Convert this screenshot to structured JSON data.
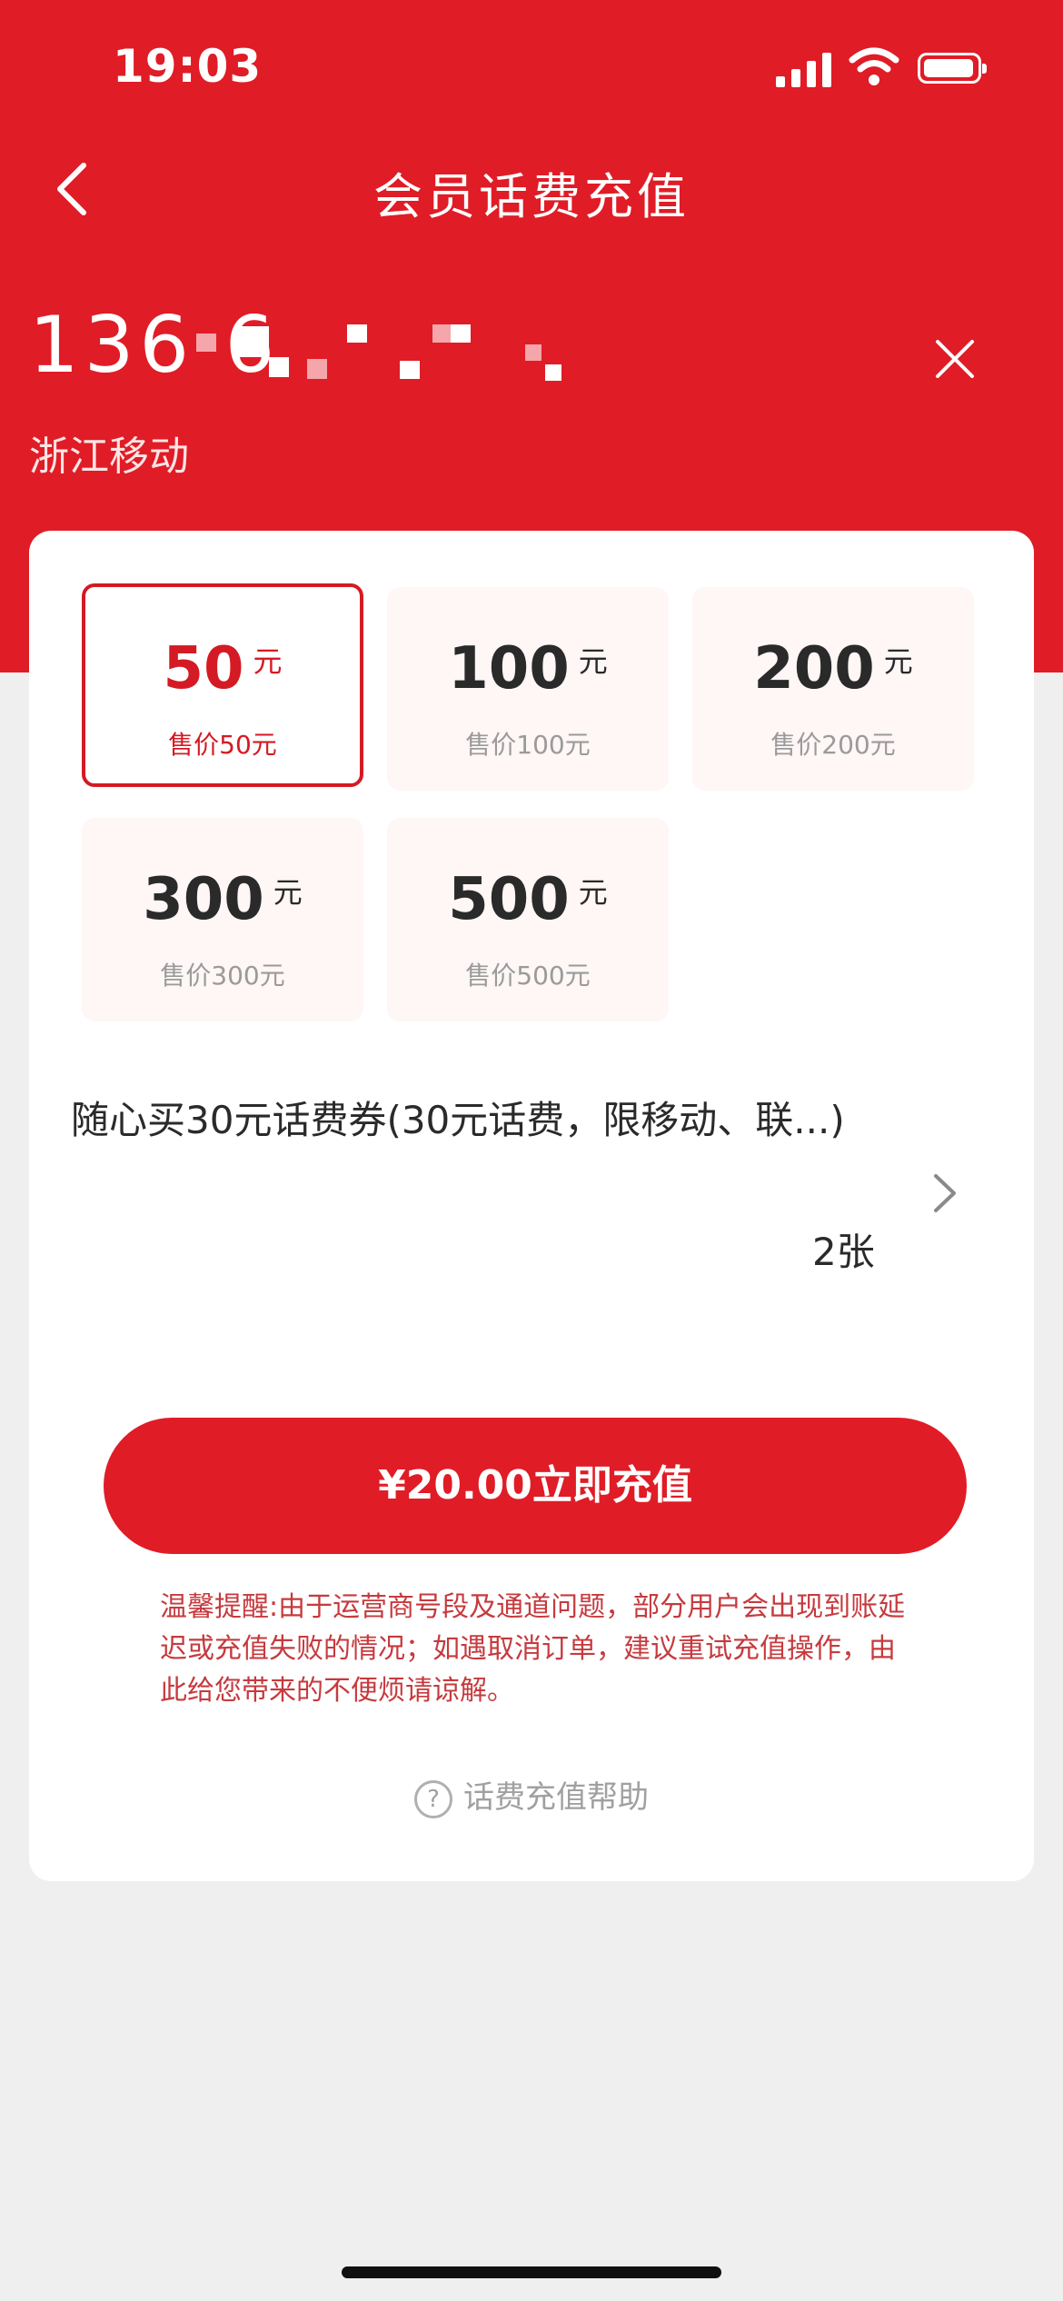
{
  "status_bar": {
    "time": "19:03"
  },
  "header": {
    "title": "会员话费充值"
  },
  "phone": {
    "number": "136 6",
    "carrier": "浙江移动"
  },
  "options": [
    {
      "amount": "50",
      "unit": "元",
      "price": "售价50元",
      "selected": true
    },
    {
      "amount": "100",
      "unit": "元",
      "price": "售价100元",
      "selected": false
    },
    {
      "amount": "200",
      "unit": "元",
      "price": "售价200元",
      "selected": false
    },
    {
      "amount": "300",
      "unit": "元",
      "price": "售价300元",
      "selected": false
    },
    {
      "amount": "500",
      "unit": "元",
      "price": "售价500元",
      "selected": false
    }
  ],
  "coupon": {
    "title": "随心买30元话费券(30元话费，限移动、联...)",
    "count": "2张"
  },
  "pay_button": {
    "label": "¥20.00立即充值"
  },
  "notice": "温馨提醒:由于运营商号段及通道问题，部分用户会出现到账延迟或充值失败的情况；如遇取消订单，建议重试充值操作，由此给您带来的不便烦请谅解。",
  "help": {
    "icon": "?",
    "label": "话费充值帮助"
  },
  "colors": {
    "primary": "#e01c26",
    "option_bg": "#fff6f6",
    "notice": "#c63a3e"
  }
}
